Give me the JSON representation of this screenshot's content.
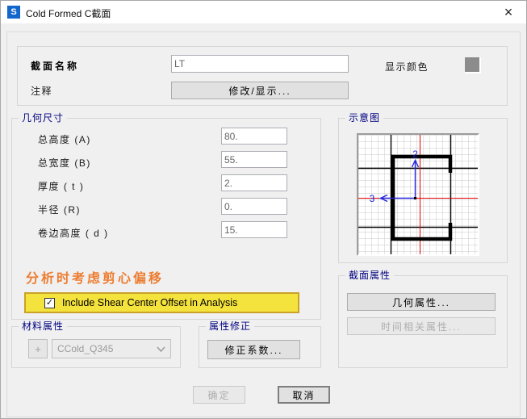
{
  "colors": {
    "accent_navy": "#000080",
    "annotation_orange": "#ED7D31",
    "highlight_yellow": "#F5E33D",
    "highlight_border": "#C9A227",
    "display_color_swatch": "#8C8C8C",
    "titlebar_icon_blue": "#1266CC",
    "schematic_axis_blue": "#2222dd",
    "schematic_centroid_red": "#e60000"
  },
  "icons": {
    "app_glyph": "S",
    "close_glyph": "×",
    "check_glyph": "✓",
    "plus_glyph": "+"
  },
  "window": {
    "title": "Cold Formed C截面"
  },
  "header": {
    "section_name_label": "截面名称",
    "section_name_value": "LT",
    "notes_label": "注释",
    "modify_show_button": "修改/显示...",
    "display_color_label": "显示颜色"
  },
  "dimensions": {
    "group_title": "几何尺寸",
    "rows": [
      {
        "label": "总高度 (A)",
        "value": "80."
      },
      {
        "label": "总宽度 (B)",
        "value": "55."
      },
      {
        "label": "厚度 ( t )",
        "value": "2."
      },
      {
        "label": "半径 (R)",
        "value": "0."
      },
      {
        "label": "卷边高度 ( d )",
        "value": "15."
      }
    ]
  },
  "shear_annotation": {
    "text": "分析时考虑剪心偏移",
    "checkbox_label": "Include Shear Center Offset in Analysis",
    "checked": true
  },
  "schematic": {
    "group_title": "示意图",
    "axis_2_label": "2",
    "axis_3_label": "3"
  },
  "section_properties": {
    "group_title": "截面属性",
    "geometric_button": "几何属性...",
    "time_dependent_button": "时间相关属性..."
  },
  "material": {
    "group_title": "材料属性",
    "selected_material": "CCold_Q345"
  },
  "modifiers": {
    "group_title": "属性修正",
    "factors_button": "修正系数..."
  },
  "footer": {
    "ok_button": "确定",
    "cancel_button": "取消"
  }
}
